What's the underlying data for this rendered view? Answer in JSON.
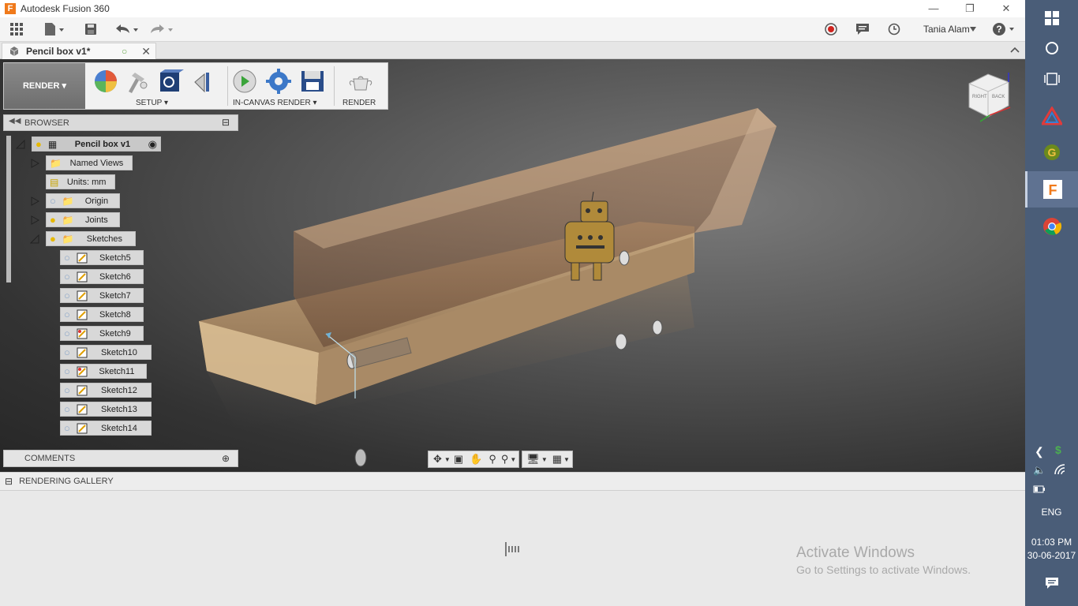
{
  "window": {
    "title": "Autodesk Fusion 360",
    "app_icon_letter": "F",
    "accent": "#f07a1b"
  },
  "user": {
    "name": "Tania Alam"
  },
  "document": {
    "tab_label": "Pencil box v1*"
  },
  "ribbon": {
    "workspace_label": "RENDER ▾",
    "groups": [
      {
        "label": "SETUP ▾"
      },
      {
        "label": "IN-CANVAS RENDER ▾"
      },
      {
        "label": "RENDER"
      }
    ]
  },
  "browser": {
    "header_label": "BROWSER",
    "root": "Pencil box v1",
    "nodes": [
      "Named Views",
      "Units: mm",
      "Origin",
      "Joints",
      "Sketches"
    ],
    "sketches": [
      "Sketch5",
      "Sketch6",
      "Sketch7",
      "Sketch8",
      "Sketch9",
      "Sketch10",
      "Sketch11",
      "Sketch12",
      "Sketch13",
      "Sketch14"
    ]
  },
  "comments": {
    "label": "COMMENTS"
  },
  "gallery": {
    "label": "RENDERING GALLERY"
  },
  "viewcube": {
    "face_right": "BACK",
    "face_left": "RIGHT"
  },
  "watermark": {
    "line1": "Activate Windows",
    "line2": "Go to Settings to activate Windows."
  },
  "taskbar": {
    "language": "ENG",
    "time": "01:03 PM",
    "date": "30-06-2017"
  }
}
